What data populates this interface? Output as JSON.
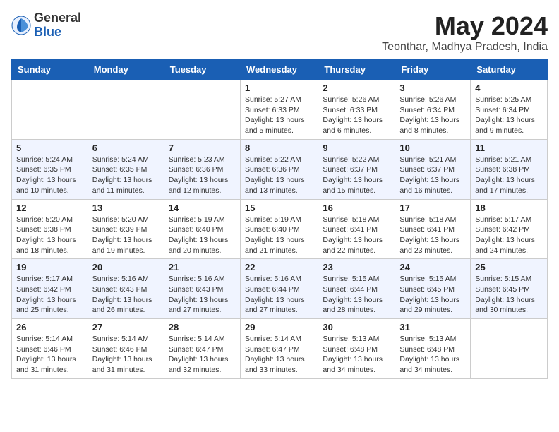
{
  "logo": {
    "general": "General",
    "blue": "Blue"
  },
  "title": "May 2024",
  "location": "Teonthar, Madhya Pradesh, India",
  "days_header": [
    "Sunday",
    "Monday",
    "Tuesday",
    "Wednesday",
    "Thursday",
    "Friday",
    "Saturday"
  ],
  "weeks": [
    [
      {
        "day": "",
        "info": ""
      },
      {
        "day": "",
        "info": ""
      },
      {
        "day": "",
        "info": ""
      },
      {
        "day": "1",
        "info": "Sunrise: 5:27 AM\nSunset: 6:33 PM\nDaylight: 13 hours\nand 5 minutes."
      },
      {
        "day": "2",
        "info": "Sunrise: 5:26 AM\nSunset: 6:33 PM\nDaylight: 13 hours\nand 6 minutes."
      },
      {
        "day": "3",
        "info": "Sunrise: 5:26 AM\nSunset: 6:34 PM\nDaylight: 13 hours\nand 8 minutes."
      },
      {
        "day": "4",
        "info": "Sunrise: 5:25 AM\nSunset: 6:34 PM\nDaylight: 13 hours\nand 9 minutes."
      }
    ],
    [
      {
        "day": "5",
        "info": "Sunrise: 5:24 AM\nSunset: 6:35 PM\nDaylight: 13 hours\nand 10 minutes."
      },
      {
        "day": "6",
        "info": "Sunrise: 5:24 AM\nSunset: 6:35 PM\nDaylight: 13 hours\nand 11 minutes."
      },
      {
        "day": "7",
        "info": "Sunrise: 5:23 AM\nSunset: 6:36 PM\nDaylight: 13 hours\nand 12 minutes."
      },
      {
        "day": "8",
        "info": "Sunrise: 5:22 AM\nSunset: 6:36 PM\nDaylight: 13 hours\nand 13 minutes."
      },
      {
        "day": "9",
        "info": "Sunrise: 5:22 AM\nSunset: 6:37 PM\nDaylight: 13 hours\nand 15 minutes."
      },
      {
        "day": "10",
        "info": "Sunrise: 5:21 AM\nSunset: 6:37 PM\nDaylight: 13 hours\nand 16 minutes."
      },
      {
        "day": "11",
        "info": "Sunrise: 5:21 AM\nSunset: 6:38 PM\nDaylight: 13 hours\nand 17 minutes."
      }
    ],
    [
      {
        "day": "12",
        "info": "Sunrise: 5:20 AM\nSunset: 6:38 PM\nDaylight: 13 hours\nand 18 minutes."
      },
      {
        "day": "13",
        "info": "Sunrise: 5:20 AM\nSunset: 6:39 PM\nDaylight: 13 hours\nand 19 minutes."
      },
      {
        "day": "14",
        "info": "Sunrise: 5:19 AM\nSunset: 6:40 PM\nDaylight: 13 hours\nand 20 minutes."
      },
      {
        "day": "15",
        "info": "Sunrise: 5:19 AM\nSunset: 6:40 PM\nDaylight: 13 hours\nand 21 minutes."
      },
      {
        "day": "16",
        "info": "Sunrise: 5:18 AM\nSunset: 6:41 PM\nDaylight: 13 hours\nand 22 minutes."
      },
      {
        "day": "17",
        "info": "Sunrise: 5:18 AM\nSunset: 6:41 PM\nDaylight: 13 hours\nand 23 minutes."
      },
      {
        "day": "18",
        "info": "Sunrise: 5:17 AM\nSunset: 6:42 PM\nDaylight: 13 hours\nand 24 minutes."
      }
    ],
    [
      {
        "day": "19",
        "info": "Sunrise: 5:17 AM\nSunset: 6:42 PM\nDaylight: 13 hours\nand 25 minutes."
      },
      {
        "day": "20",
        "info": "Sunrise: 5:16 AM\nSunset: 6:43 PM\nDaylight: 13 hours\nand 26 minutes."
      },
      {
        "day": "21",
        "info": "Sunrise: 5:16 AM\nSunset: 6:43 PM\nDaylight: 13 hours\nand 27 minutes."
      },
      {
        "day": "22",
        "info": "Sunrise: 5:16 AM\nSunset: 6:44 PM\nDaylight: 13 hours\nand 27 minutes."
      },
      {
        "day": "23",
        "info": "Sunrise: 5:15 AM\nSunset: 6:44 PM\nDaylight: 13 hours\nand 28 minutes."
      },
      {
        "day": "24",
        "info": "Sunrise: 5:15 AM\nSunset: 6:45 PM\nDaylight: 13 hours\nand 29 minutes."
      },
      {
        "day": "25",
        "info": "Sunrise: 5:15 AM\nSunset: 6:45 PM\nDaylight: 13 hours\nand 30 minutes."
      }
    ],
    [
      {
        "day": "26",
        "info": "Sunrise: 5:14 AM\nSunset: 6:46 PM\nDaylight: 13 hours\nand 31 minutes."
      },
      {
        "day": "27",
        "info": "Sunrise: 5:14 AM\nSunset: 6:46 PM\nDaylight: 13 hours\nand 31 minutes."
      },
      {
        "day": "28",
        "info": "Sunrise: 5:14 AM\nSunset: 6:47 PM\nDaylight: 13 hours\nand 32 minutes."
      },
      {
        "day": "29",
        "info": "Sunrise: 5:14 AM\nSunset: 6:47 PM\nDaylight: 13 hours\nand 33 minutes."
      },
      {
        "day": "30",
        "info": "Sunrise: 5:13 AM\nSunset: 6:48 PM\nDaylight: 13 hours\nand 34 minutes."
      },
      {
        "day": "31",
        "info": "Sunrise: 5:13 AM\nSunset: 6:48 PM\nDaylight: 13 hours\nand 34 minutes."
      },
      {
        "day": "",
        "info": ""
      }
    ]
  ]
}
